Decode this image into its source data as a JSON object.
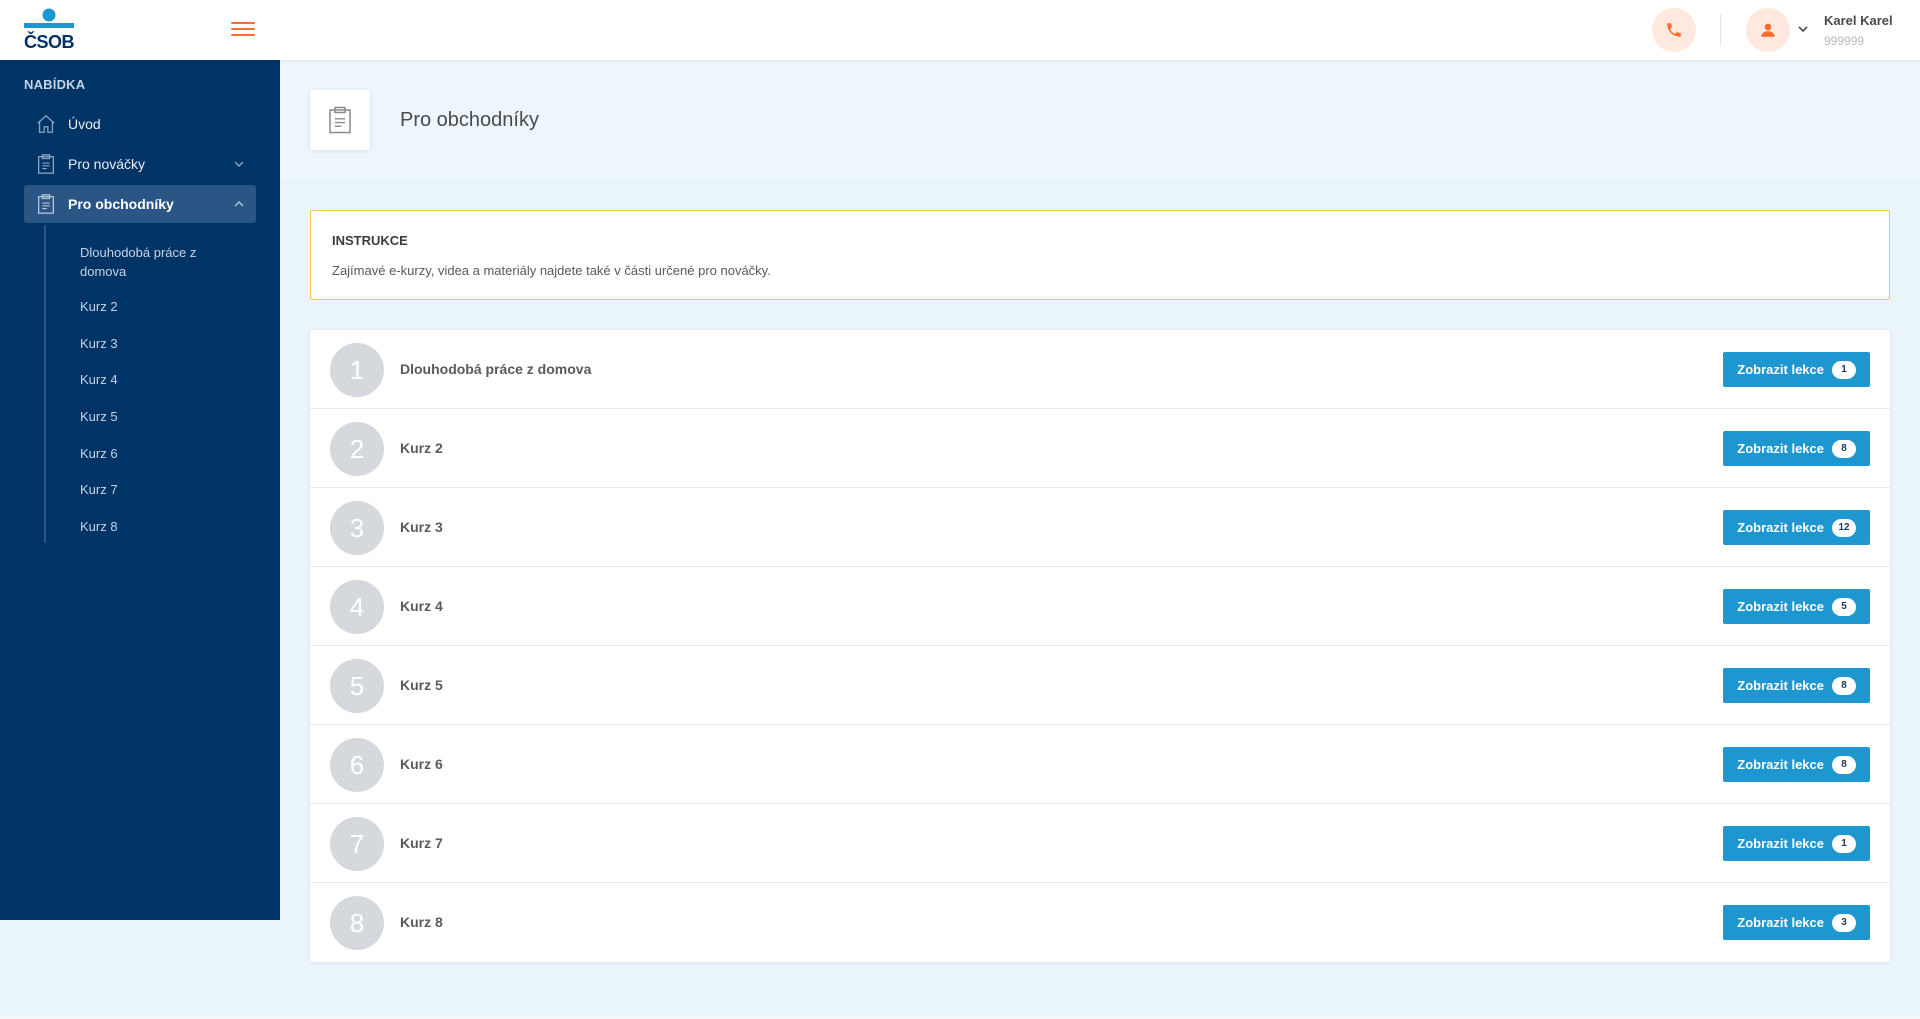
{
  "brand": {
    "logo_text": "ČSOB",
    "accent_color": "#ff6d2d",
    "sidebar_color": "#003366",
    "button_color": "#1e96cf"
  },
  "header": {
    "phone_icon": "phone-icon",
    "user": {
      "name": "Karel Karel",
      "id": "999999"
    }
  },
  "sidebar": {
    "heading": "NABÍDKA",
    "items": [
      {
        "label": "Úvod",
        "icon": "home-icon"
      },
      {
        "label": "Pro nováčky",
        "icon": "clipboard-icon"
      },
      {
        "label": "Pro obchodníky",
        "icon": "clipboard-icon"
      }
    ],
    "subitems": [
      "Dlouhodobá práce z domova",
      "Kurz 2",
      "Kurz 3",
      "Kurz 4",
      "Kurz 5",
      "Kurz 6",
      "Kurz 7",
      "Kurz 8"
    ]
  },
  "page": {
    "title": "Pro obchodníky",
    "icon": "clipboard-icon"
  },
  "instructions": {
    "title": "INSTRUKCE",
    "text": "Zajímavé e-kurzy, videa a materiály najdete také v části určené pro nováčky."
  },
  "courses": [
    {
      "num": "1",
      "name": "Dlouhodobá práce z domova",
      "button": "Zobrazit lekce",
      "count": "1"
    },
    {
      "num": "2",
      "name": "Kurz 2",
      "button": "Zobrazit lekce",
      "count": "8"
    },
    {
      "num": "3",
      "name": "Kurz 3",
      "button": "Zobrazit lekce",
      "count": "12"
    },
    {
      "num": "4",
      "name": "Kurz 4",
      "button": "Zobrazit lekce",
      "count": "5"
    },
    {
      "num": "5",
      "name": "Kurz 5",
      "button": "Zobrazit lekce",
      "count": "8"
    },
    {
      "num": "6",
      "name": "Kurz 6",
      "button": "Zobrazit lekce",
      "count": "8"
    },
    {
      "num": "7",
      "name": "Kurz 7",
      "button": "Zobrazit lekce",
      "count": "1"
    },
    {
      "num": "8",
      "name": "Kurz 8",
      "button": "Zobrazit lekce",
      "count": "3"
    }
  ]
}
